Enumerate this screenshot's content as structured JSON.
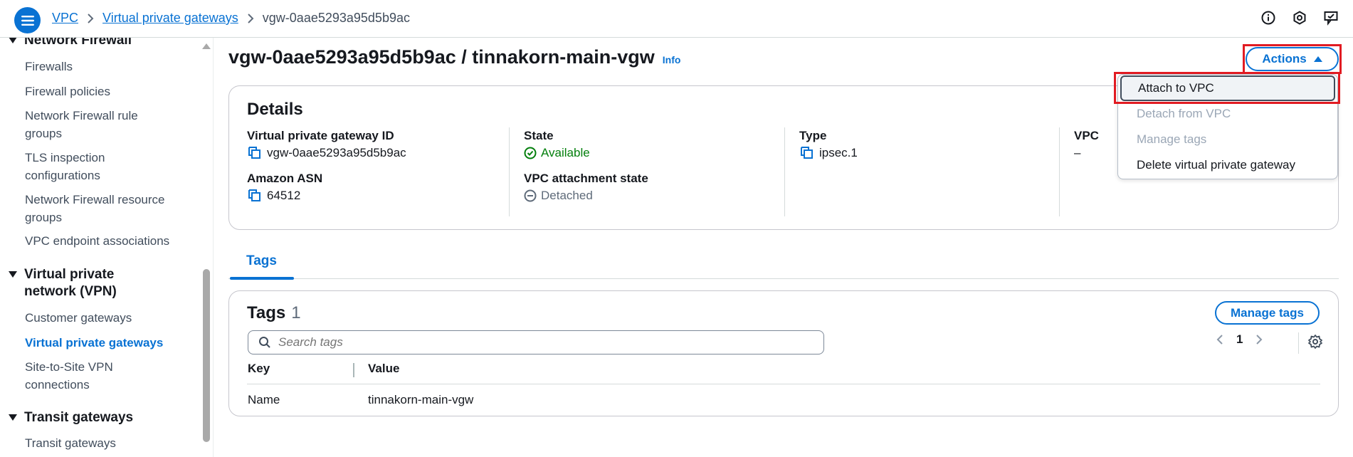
{
  "breadcrumb": {
    "items": [
      "VPC",
      "Virtual private gateways"
    ],
    "current": "vgw-0aae5293a95d5b9ac"
  },
  "topbar": {
    "icons": [
      "info-circle-icon",
      "settings-hexagon-icon",
      "feedback-icon"
    ]
  },
  "sidebar": {
    "sections": [
      {
        "title": "Network Firewall",
        "items": [
          "Firewalls",
          "Firewall policies",
          "Network Firewall rule groups",
          "TLS inspection configurations",
          "Network Firewall resource groups",
          "VPC endpoint associations"
        ]
      },
      {
        "title": "Virtual private network (VPN)",
        "items": [
          "Customer gateways",
          "Virtual private gateways",
          "Site-to-Site VPN connections"
        ],
        "active": "Virtual private gateways"
      },
      {
        "title": "Transit gateways",
        "items": [
          "Transit gateways"
        ]
      }
    ]
  },
  "page": {
    "title": "vgw-0aae5293a95d5b9ac / tinnakorn-main-vgw",
    "info": "Info",
    "actions_label": "Actions"
  },
  "actions_menu": {
    "items": [
      "Attach to VPC",
      "Detach from VPC",
      "Manage tags",
      "Delete virtual private gateway"
    ]
  },
  "details": {
    "title": "Details",
    "vgw_id_label": "Virtual private gateway ID",
    "vgw_id": "vgw-0aae5293a95d5b9ac",
    "asn_label": "Amazon ASN",
    "asn": "64512",
    "state_label": "State",
    "state": "Available",
    "attach_state_label": "VPC attachment state",
    "attach_state": "Detached",
    "type_label": "Type",
    "type": "ipsec.1",
    "vpc_label": "VPC",
    "vpc": "–"
  },
  "tabs": {
    "items": [
      "Tags"
    ]
  },
  "tags": {
    "title": "Tags",
    "count": "1",
    "manage_label": "Manage tags",
    "search_placeholder": "Search tags",
    "page": "1",
    "columns": [
      "Key",
      "Value"
    ],
    "rows": [
      {
        "key": "Name",
        "value": "tinnakorn-main-vgw"
      }
    ]
  },
  "colors": {
    "accent": "#0972d3",
    "success": "#037f0c",
    "highlight_border": "#e11b22"
  }
}
